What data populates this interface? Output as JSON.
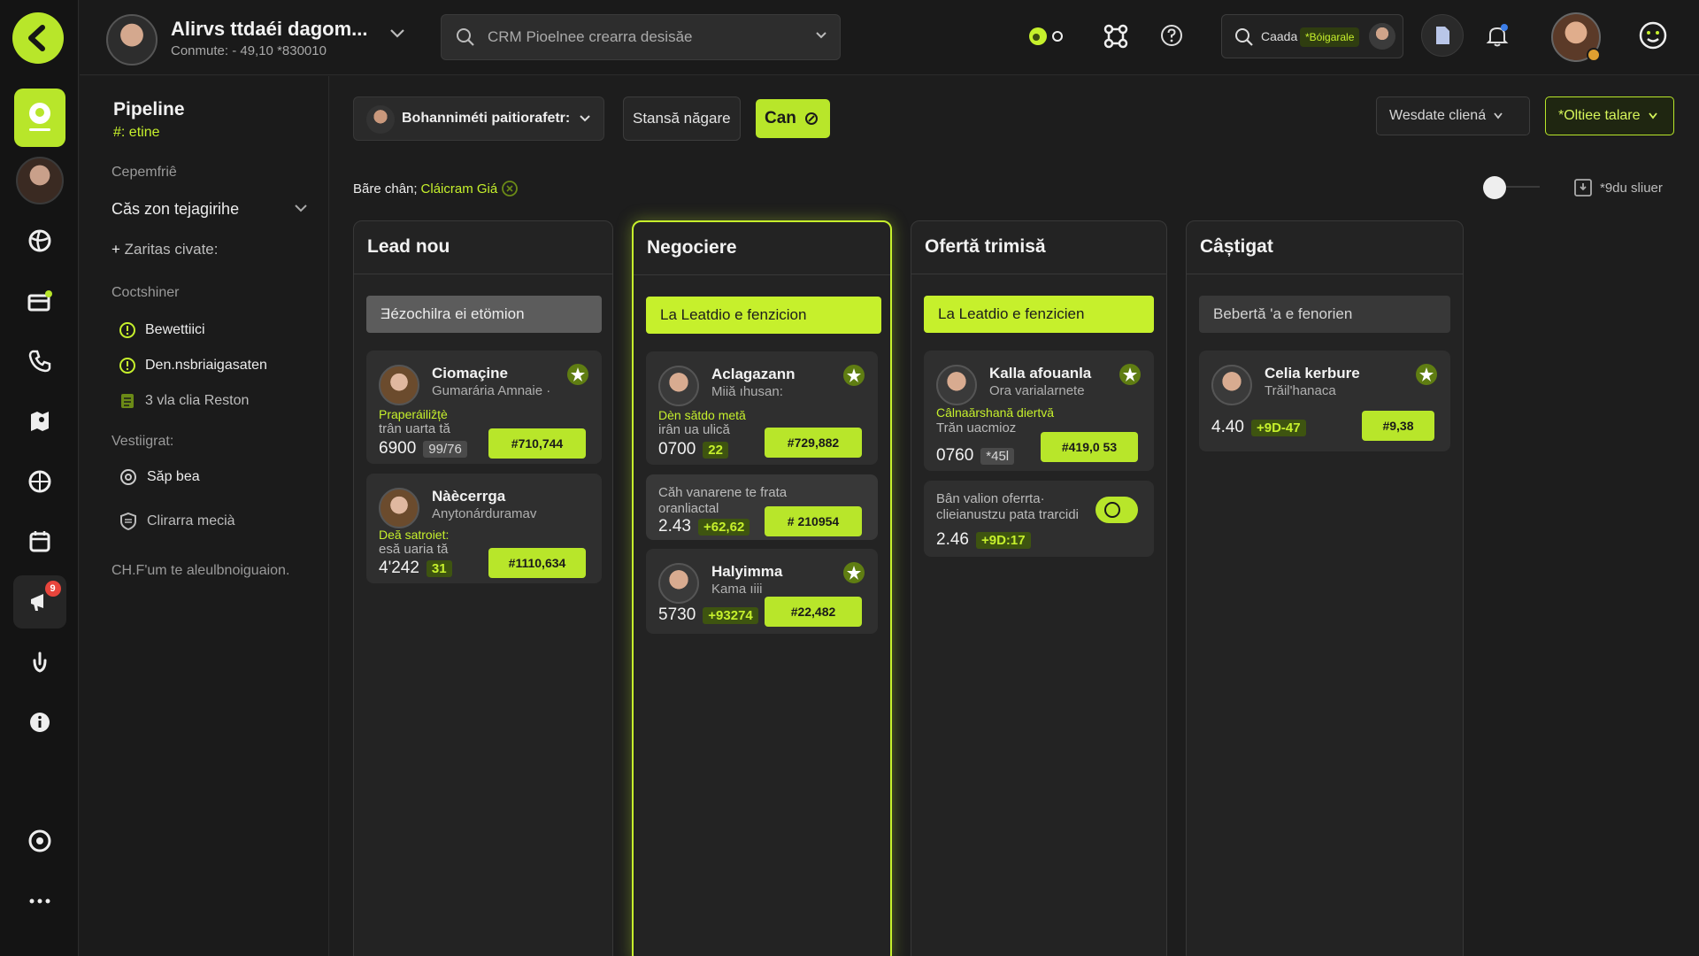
{
  "topbar": {
    "user_name": "Alirvs ttdaéi dagom...",
    "user_sub": "Conmute: - 49,10 *830010",
    "search_placeholder": "CRM Pioelnee crearra desisăe",
    "workspace_label": "Caada",
    "workspace_tag": "*Bóigarale"
  },
  "panel": {
    "title": "Pipeline",
    "subtitle": "#: etine",
    "section1": "Cepemfriê",
    "dropdown": "Căs zon tejagirihe",
    "add_label": "Zaritas civate:",
    "section2": "Coctshiner",
    "items": [
      {
        "label": "Bewettiici"
      },
      {
        "label": "Den.nsbriaigasaten"
      },
      {
        "label": "3 vla clia Reston"
      }
    ],
    "section3": "Vestiigrat:",
    "links": [
      {
        "label": "Săp bea"
      },
      {
        "label": "Clirarra mecià"
      }
    ],
    "footer": "CH.F'um te aleulbnoiguaion."
  },
  "toolbar": {
    "owner_label": "Bohanniméti paitiorafetr:",
    "btn_stage": "Stansă năgare",
    "btn_create": "Can",
    "btn_filter": "Wesdate cliená",
    "btn_options": "*Oltiee talare"
  },
  "filter": {
    "prefix": "Bãre chân;",
    "value": "Cláicram Giá"
  },
  "view": {
    "label": "*9du sliuer"
  },
  "notifications": {
    "count": "9"
  },
  "columns": [
    {
      "title": "Lead nou",
      "pill": "Ǝézochilra ei etömion",
      "cards": [
        {
          "name": "Ciomaçine",
          "role": "Gumarária Amnaie ·",
          "k_lbl": "Praperáiliẑțè",
          "k_sub": "trân uarta tă",
          "value": "6900",
          "chip": "99/76",
          "amount": "#710,744"
        },
        {
          "name": "Nàècerrga",
          "role": "Anytonárduramav",
          "k_lbl": "Deă satroiet:",
          "k_sub": "esă uaria tă",
          "value": "4'242",
          "chip": "31",
          "amount": "#1110,634"
        }
      ]
    },
    {
      "title": "Negociere",
      "pill": "La Leatdio e fenzicion",
      "cards": [
        {
          "name": "Aclagazann",
          "role": "Miiă ıhusan:",
          "k_lbl": "Dèn sătdo metă",
          "k_sub": "irân ua ulică",
          "value": "0700",
          "chip": "22",
          "amount": "#729,882"
        },
        {
          "note": "Căh vanarene te frata oranliactal",
          "value": "2.43",
          "chip": "+62,62",
          "amount": "# 210954"
        },
        {
          "name": "Halyimma",
          "role": "Kama ıiii",
          "value": "5730",
          "chip": "+93274",
          "amount": "#22,482"
        }
      ]
    },
    {
      "title": "Ofertă trimisă",
      "pill": "La Leatdio e fenzicien",
      "cards": [
        {
          "name": "Kalla afouanla",
          "role": "Ora varialarnete",
          "k_lbl": "Câlnaărshană diertvă",
          "k_sub": "Trăn uacmioz",
          "value": "0760",
          "chip": "*45l",
          "amount": "#419,0 53"
        },
        {
          "note": "Bân valion oferrta· clieianustzu pata trarcidi",
          "value": "2.46",
          "chip": "+9D:17"
        }
      ]
    },
    {
      "title": "Câștigat",
      "pill": "Bebertă 'a e fenorien",
      "cards": [
        {
          "name": "Celia kerbure",
          "role": "Trăil'hanaca",
          "value": "4.40",
          "chip": "+9D-47",
          "amount": "#9,38"
        }
      ]
    }
  ],
  "colors": {
    "accent": "#c6f02c",
    "bg": "#1d1d1d",
    "card": "#2f2f2f"
  }
}
